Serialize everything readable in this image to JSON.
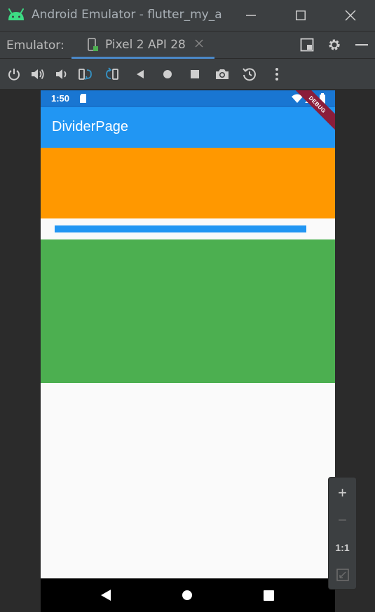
{
  "window": {
    "title": "Android Emulator - flutter_my_a",
    "minimize_icon": "minimize-icon",
    "maximize_icon": "maximize-icon",
    "close_icon": "close-icon"
  },
  "tabbar": {
    "label": "Emulator:",
    "tab_label": "Pixel 2 API 28",
    "accent": "#4a88c7"
  },
  "toolbar": {
    "items": [
      "power-icon",
      "volume-up-icon",
      "volume-down-icon",
      "rotate-left-icon",
      "rotate-right-icon",
      "back-icon",
      "home-icon",
      "overview-icon",
      "screenshot-icon",
      "snapshot-icon",
      "more-icon"
    ]
  },
  "phone": {
    "status_time": "1:50",
    "app_title": "DividerPage",
    "debug_banner": "DEBUG",
    "colors": {
      "status": "#1976d2",
      "appbar": "#2196f3",
      "orange": "#ff9800",
      "divider": "#2196f3",
      "green": "#4caf50",
      "background": "#fafafa"
    }
  },
  "zoom": {
    "plus": "+",
    "minus": "−",
    "one_to_one": "1:1",
    "fit_icon": "fit-screen-icon"
  }
}
